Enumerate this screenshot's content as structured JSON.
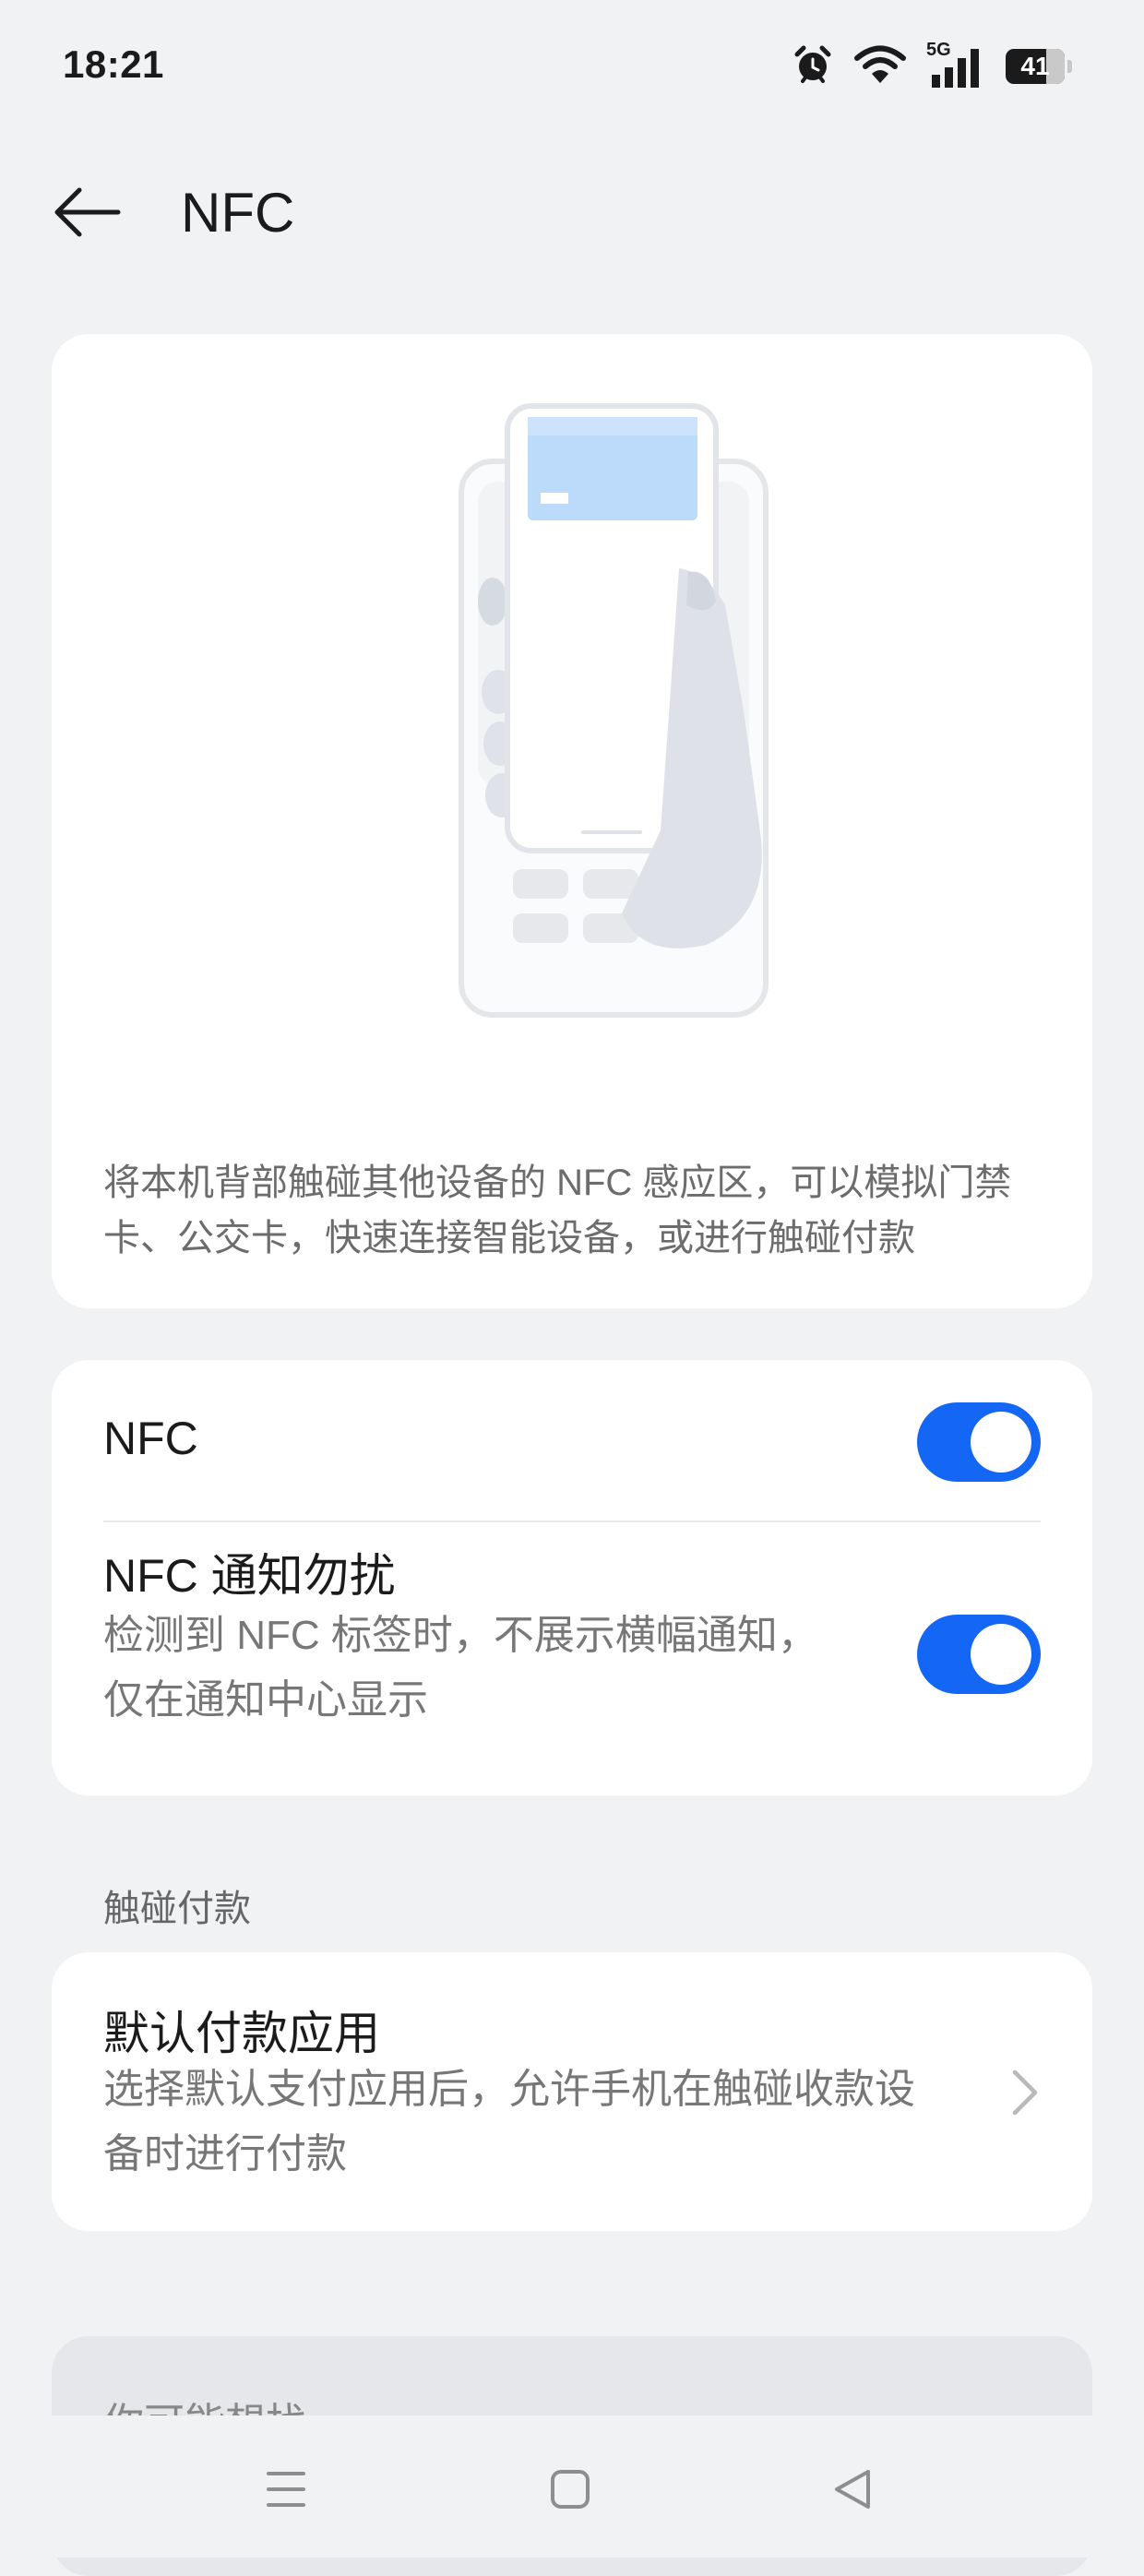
{
  "status_bar": {
    "time": "18:21",
    "network": "5G",
    "battery": "41",
    "icons": [
      "alarm-icon",
      "wifi-icon",
      "signal-icon",
      "battery-icon"
    ]
  },
  "header": {
    "title": "NFC",
    "back_icon": "back-arrow-icon"
  },
  "intro": {
    "illustration": "phone-tap-nfc-terminal-illustration",
    "description": "将本机背部触碰其他设备的 NFC 感应区，可以模拟门禁卡、公交卡，快速连接智能设备，或进行触碰付款"
  },
  "settings": [
    {
      "title": "NFC",
      "subtitle": "",
      "enabled": true
    },
    {
      "title": "NFC 通知勿扰",
      "subtitle": "检测到 NFC 标签时，不展示横幅通知，仅在通知中心显示",
      "enabled": true
    }
  ],
  "payment": {
    "section_label": "触碰付款",
    "title": "默认付款应用",
    "subtitle": "选择默认支付应用后，允许手机在触碰收款设备时进行付款"
  },
  "partial": {
    "text": "你可能想找"
  },
  "navbar": {
    "icons": [
      "menu-icon",
      "home-icon",
      "back-icon"
    ]
  },
  "colors": {
    "accent": "#1466f4",
    "background": "#f1f2f4",
    "card": "#ffffff"
  }
}
